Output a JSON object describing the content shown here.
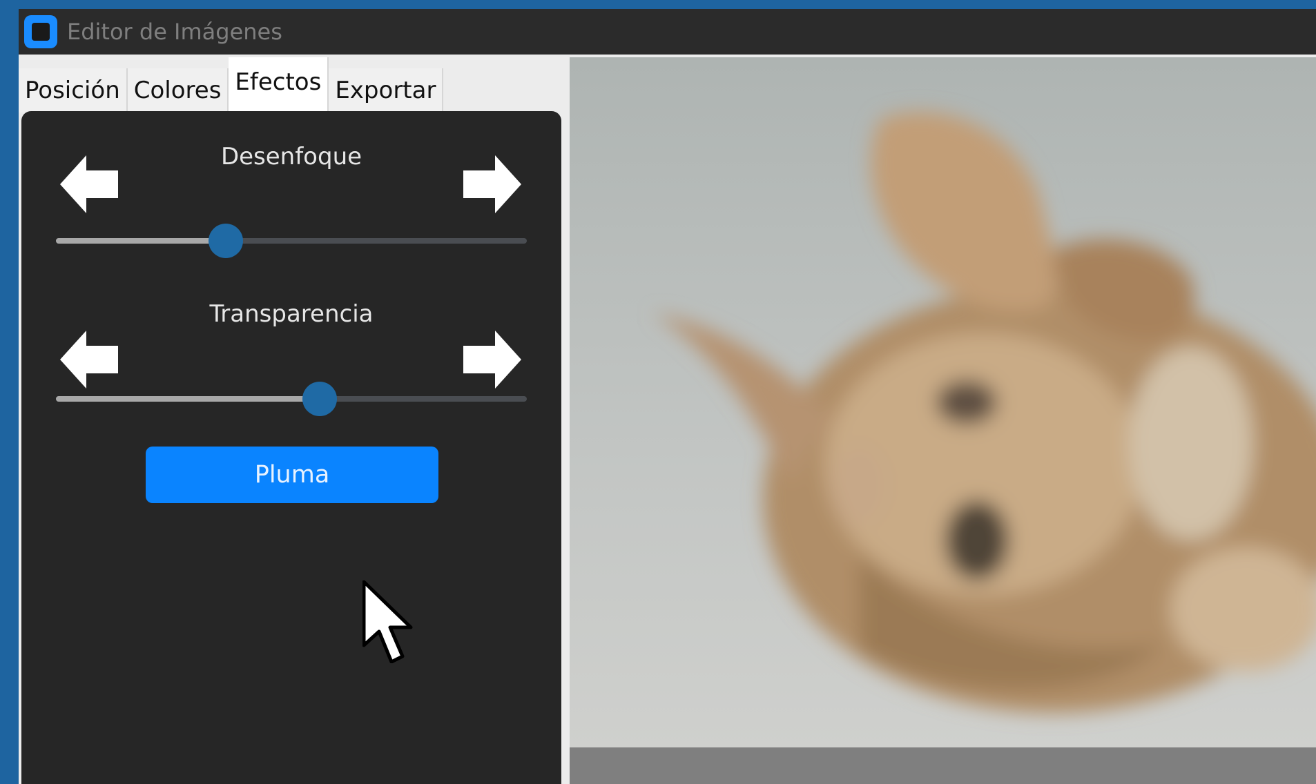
{
  "window": {
    "title": "Editor de Imágenes"
  },
  "tabs": [
    {
      "label": "Posición",
      "active": false
    },
    {
      "label": "Colores",
      "active": false
    },
    {
      "label": "Efectos",
      "active": true
    },
    {
      "label": "Exportar",
      "active": false
    }
  ],
  "effects": {
    "blur": {
      "label": "Desenfoque",
      "value": 0.36
    },
    "transparency": {
      "label": "Transparencia",
      "value": 0.56
    },
    "feather_button": {
      "label": "Pluma"
    }
  },
  "image_preview": {
    "subject": "blurred photo of an orange kitten lying on its back"
  },
  "colors": {
    "accent": "#0a84ff",
    "slider_thumb": "#1f6aa5",
    "panel_bg": "#262626",
    "desktop_bg": "#1e64a0"
  },
  "icons": {
    "app": "app-icon",
    "decrease": "arrow-left-icon",
    "increase": "arrow-right-icon",
    "pointer": "mouse-pointer-icon"
  }
}
